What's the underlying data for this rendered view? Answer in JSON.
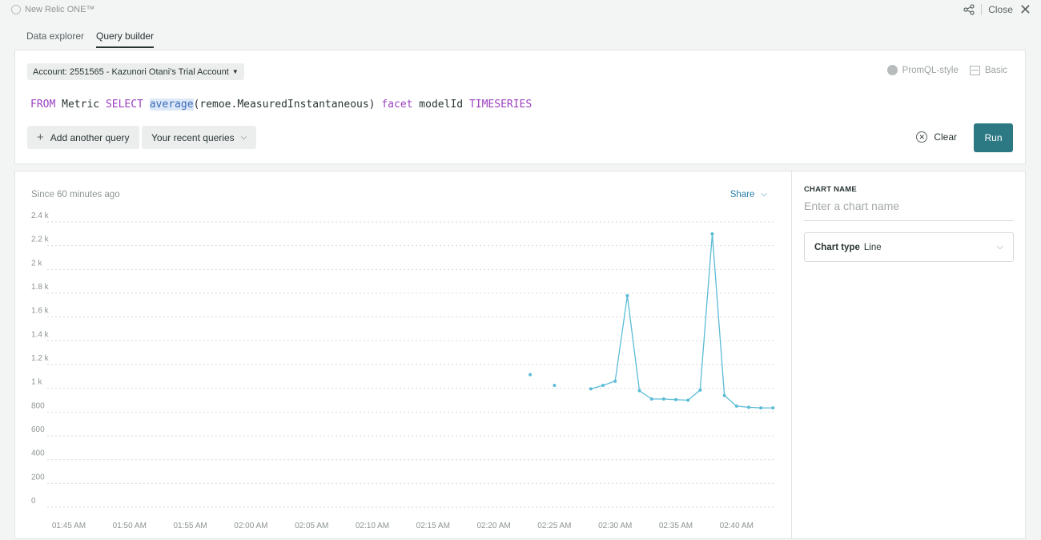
{
  "app": {
    "name": "New Relic ONE™",
    "share_icon": "share-nodes-icon",
    "close_label": "Close"
  },
  "tabs": [
    {
      "label": "Data explorer",
      "active": false
    },
    {
      "label": "Query builder",
      "active": true
    }
  ],
  "query": {
    "account_label": "Account: 2551565 - Kazunori Otani's Trial Account",
    "modes": {
      "promql": "PromQL-style",
      "basic": "Basic"
    },
    "nrql": {
      "t1": "FROM",
      "t2": " Metric ",
      "t3": "SELECT",
      "t4": " ",
      "t5": "average",
      "t6": "(remoe.MeasuredInstantaneous) ",
      "t7": "facet",
      "t8": " modelId ",
      "t9": "TIMESERIES"
    },
    "add_query": "Add another query",
    "recent_queries": "Your recent queries",
    "clear": "Clear",
    "run": "Run"
  },
  "chart_header": {
    "since": "Since 60 minutes ago",
    "share": "Share"
  },
  "settings": {
    "chart_name_label": "CHART NAME",
    "chart_name_placeholder": "Enter a chart name",
    "chart_type_label": "Chart type",
    "chart_type_value": "Line"
  },
  "colors": {
    "accent": "#2c7983",
    "series": "#5bbcd6",
    "keyword": "#9b3fbf",
    "link": "#2a7fa8"
  },
  "chart_data": {
    "type": "line",
    "title": "",
    "xlabel": "",
    "ylabel": "",
    "ylim": [
      0,
      2400
    ],
    "y_ticks": [
      "0",
      "200",
      "400",
      "600",
      "800",
      "1 k",
      "1.2 k",
      "1.4 k",
      "1.6 k",
      "1.8 k",
      "2 k",
      "2.2 k",
      "2.4 k"
    ],
    "x_ticks": [
      "01:45 AM",
      "01:50 AM",
      "01:55 AM",
      "02:00 AM",
      "02:05 AM",
      "02:10 AM",
      "02:15 AM",
      "02:20 AM",
      "02:25 AM",
      "02:30 AM",
      "02:35 AM",
      "02:40 AM"
    ],
    "grid": true,
    "series": [
      {
        "values": [
          [
            "02:23 AM",
            1115
          ],
          [
            "02:25 AM",
            1025
          ],
          [
            "02:28 AM",
            995
          ],
          [
            "02:29 AM",
            1025
          ],
          [
            "02:30 AM",
            1060
          ],
          [
            "02:31 AM",
            1780
          ],
          [
            "02:32 AM",
            980
          ],
          [
            "02:33 AM",
            910
          ],
          [
            "02:34 AM",
            910
          ],
          [
            "02:35 AM",
            905
          ],
          [
            "02:36 AM",
            900
          ],
          [
            "02:37 AM",
            985
          ],
          [
            "02:38 AM",
            2300
          ],
          [
            "02:39 AM",
            940
          ],
          [
            "02:40 AM",
            850
          ],
          [
            "02:41 AM",
            840
          ],
          [
            "02:42 AM",
            835
          ],
          [
            "02:43 AM",
            835
          ]
        ]
      }
    ]
  }
}
